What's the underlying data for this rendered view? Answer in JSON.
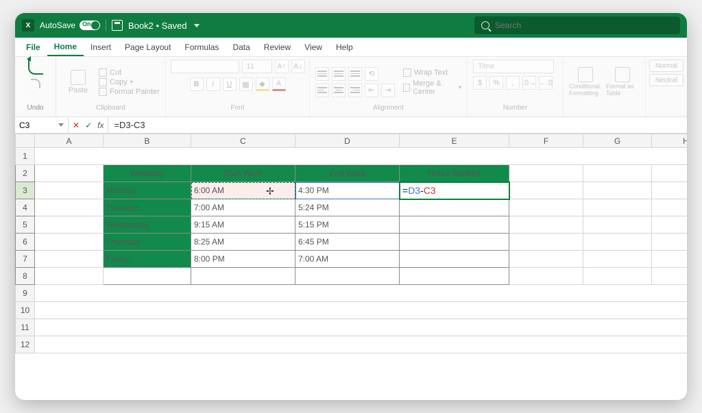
{
  "titlebar": {
    "autosave_label": "AutoSave",
    "switch_text": "On",
    "doc_title": "Book2 • Saved",
    "search_placeholder": "Search"
  },
  "menu": {
    "file": "File",
    "home": "Home",
    "insert": "Insert",
    "page_layout": "Page Layout",
    "formulas": "Formulas",
    "data": "Data",
    "review": "Review",
    "view": "View",
    "help": "Help"
  },
  "ribbon": {
    "undo": "Undo",
    "paste": "Paste",
    "cut": "Cut",
    "copy": "Copy",
    "fmt_painter": "Format Painter",
    "clipboard": "Clipboard",
    "font_size": "11",
    "font": "Font",
    "wrap": "Wrap Text",
    "merge": "Merge & Center",
    "alignment": "Alignment",
    "number_fmt": "Time",
    "number": "Number",
    "cond_fmt": "Conditional Formatting",
    "fmt_table": "Format as Table",
    "style_normal": "Normal",
    "style_neutral": "Neutral"
  },
  "formula_bar": {
    "cell_ref": "C3",
    "formula": "=D3-C3"
  },
  "columns": [
    "A",
    "B",
    "C",
    "D",
    "E",
    "F",
    "G",
    "H"
  ],
  "rows": [
    "1",
    "2",
    "3",
    "4",
    "5",
    "6",
    "7",
    "8",
    "9",
    "10",
    "11",
    "12"
  ],
  "table": {
    "headers": {
      "weekday": "Weekday",
      "start": "Start Work",
      "end": "End Work",
      "hours": "Hours Worked"
    },
    "rows": [
      {
        "weekday": "Monday",
        "start": "6:00 AM",
        "end": "4:30 PM",
        "hours_formula": {
          "eq": "=",
          "d": "D3",
          "dash": "-",
          "c": "C3"
        }
      },
      {
        "weekday": "Tuesday",
        "start": "7:00 AM",
        "end": "5:24 PM"
      },
      {
        "weekday": "Wednesday",
        "start": "9:15 AM",
        "end": "5:15 PM"
      },
      {
        "weekday": "Thursday",
        "start": "8:25 AM",
        "end": "6:45 PM"
      },
      {
        "weekday": "Friday",
        "start": "8:00 PM",
        "end": "7:00 AM"
      }
    ]
  }
}
